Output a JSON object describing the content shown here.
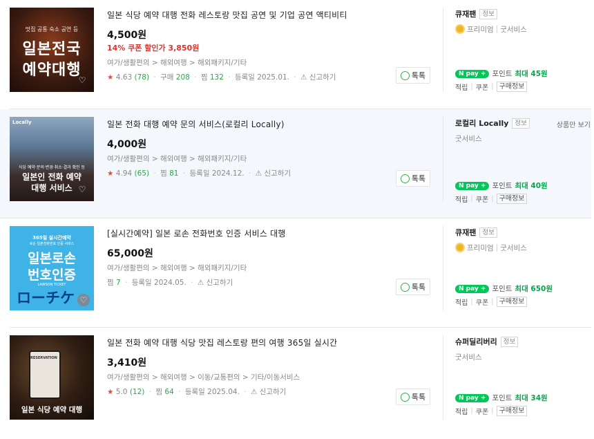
{
  "products": [
    {
      "title": "일본 식당 예약 대행 전화 레스토랑 맛집 공연 및 기업 공연 액티비티",
      "price": "4,500원",
      "coupon": "14% 쿠폰 할인가 3,850원",
      "category": "여가/생활편의 > 해외여행 > 해외패키지/기타",
      "rating": "4.63",
      "review_count": "(78)",
      "purchase_label": "구매",
      "purchase_count": "208",
      "wish_label": "찜",
      "wish_count": "132",
      "registered": "등록일 2025.01.",
      "report": "신고하기",
      "talk": "톡톡",
      "thumb_small": "맛집 공통 숙소 공연 등",
      "thumb_line1": "일본전국",
      "thumb_line2": "예약대행",
      "seller": "큐재팬",
      "seller_info": "정보",
      "grade": "프리미엄",
      "grade_sub": "굿서비스",
      "npay_point": "포인트",
      "npay_max": "최대 45원",
      "benefit1": "적립",
      "benefit2": "쿠폰",
      "benefit3": "구매정보"
    },
    {
      "title": "일본 전화 대행 예약 문의 서비스(로컬리 Locally)",
      "price": "4,000원",
      "category": "여가/생활편의 > 해외여행 > 해외패키지/기타",
      "rating": "4.94",
      "review_count": "(65)",
      "wish_label": "찜",
      "wish_count": "81",
      "registered": "등록일 2024.12.",
      "report": "신고하기",
      "talk": "톡톡",
      "thumb_brand": "Locally",
      "thumb_small": "식당 예약·문의·변경·취소·결과 확인 등",
      "thumb_line1": "일본인 전화 예약",
      "thumb_line2": "대행 서비스",
      "seller": "로컬리 Locally",
      "seller_info": "정보",
      "only_view": "상품만 보기",
      "grade_sub": "굿서비스",
      "npay_point": "포인트",
      "npay_max": "최대 40원",
      "benefit1": "적립",
      "benefit2": "쿠폰",
      "benefit3": "구매정보"
    },
    {
      "title": "[실시간예약] 일본 로손 전화번호 인증 서비스 대행",
      "price": "65,000원",
      "category": "여가/생활편의 > 해외여행 > 해외패키지/기타",
      "wish_label": "찜",
      "wish_count": "7",
      "registered": "등록일 2024.05.",
      "report": "신고하기",
      "talk": "톡톡",
      "thumb_small": "365일 실시간예약",
      "thumb_small2": "로손 일본전화번호 인증 서비스",
      "thumb_line1": "일본로손",
      "thumb_line2": "번호인증",
      "thumb_ticket": "LAWSON TICKET",
      "thumb_logo": "ローチケ",
      "seller": "큐재팬",
      "seller_info": "정보",
      "grade": "프리미엄",
      "grade_sub": "굿서비스",
      "npay_point": "포인트",
      "npay_max": "최대 650원",
      "benefit1": "적립",
      "benefit2": "쿠폰",
      "benefit3": "구매정보"
    },
    {
      "title": "일본 전화 예약 대행 식당 맛집 레스토랑 편의 여행 365일 실시간",
      "price": "3,410원",
      "category": "여가/생활편의 > 해외여행 > 이동/교통편의 > 기타/이동서비스",
      "rating": "5.0",
      "review_count": "(12)",
      "wish_label": "찜",
      "wish_count": "64",
      "registered": "등록일 2025.04.",
      "report": "신고하기",
      "talk": "톡톡",
      "thumb_small": "RESERVATION",
      "thumb_line1": "일본 식당 예약 대행",
      "seller": "슈퍼딜리버리",
      "seller_info": "정보",
      "grade_sub": "굿서비스",
      "npay_point": "포인트",
      "npay_max": "최대 34원",
      "benefit1": "적립",
      "benefit2": "쿠폰",
      "benefit3": "구매정보"
    }
  ],
  "npay_label": "pay",
  "colors": {
    "accent_red": "#e0322d",
    "npay_green": "#03c75a",
    "count_green": "#2ca64a",
    "highlight_bg": "#f4f8fc"
  }
}
